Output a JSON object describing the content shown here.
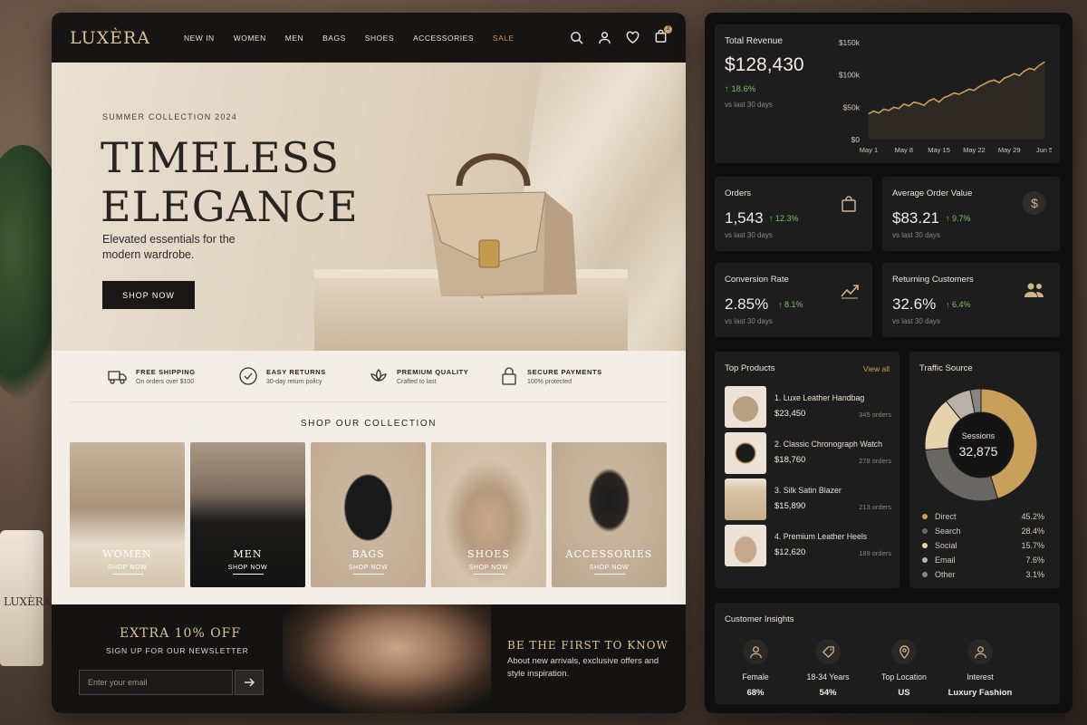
{
  "store": {
    "logo": "LUXÈRA",
    "nav": [
      "NEW IN",
      "WOMEN",
      "MEN",
      "BAGS",
      "SHOES",
      "ACCESSORIES",
      "SALE"
    ],
    "cart_count": "2",
    "hero": {
      "eyebrow": "SUMMER COLLECTION 2024",
      "title": "TIMELESS\nELEGANCE",
      "subtitle": "Elevated essentials for the modern wardrobe.",
      "cta": "SHOP NOW"
    },
    "features": [
      {
        "title": "FREE SHIPPING",
        "sub": "On orders over $100",
        "icon": "truck-icon"
      },
      {
        "title": "EASY RETURNS",
        "sub": "30-day return policy",
        "icon": "return-icon"
      },
      {
        "title": "PREMIUM QUALITY",
        "sub": "Crafted to last",
        "icon": "lotus-icon"
      },
      {
        "title": "SECURE PAYMENTS",
        "sub": "100% protected",
        "icon": "lock-icon"
      }
    ],
    "collection_title": "SHOP OUR COLLECTION",
    "categories": [
      {
        "label": "WOMEN",
        "cta": "SHOP NOW"
      },
      {
        "label": "MEN",
        "cta": "SHOP NOW"
      },
      {
        "label": "BAGS",
        "cta": "SHOP NOW"
      },
      {
        "label": "SHOES",
        "cta": "SHOP NOW"
      },
      {
        "label": "ACCESSORIES",
        "cta": "SHOP NOW"
      }
    ],
    "newsletter": {
      "headline": "EXTRA 10% OFF",
      "sub": "SIGN UP FOR OUR NEWSLETTER",
      "placeholder": "Enter your email",
      "right_title": "BE THE FIRST TO KNOW",
      "right_text": "About new arrivals, exclusive offers and style inspiration."
    }
  },
  "dashboard": {
    "revenue": {
      "title": "Total Revenue",
      "value": "$128,430",
      "change": "↑ 18.6%",
      "period": "vs last 30 days",
      "y_ticks": [
        "$150k",
        "$100k",
        "$50k",
        "$0"
      ],
      "x_ticks": [
        "May 1",
        "May 8",
        "May 15",
        "May 22",
        "May 29",
        "Jun 5"
      ]
    },
    "kpis": [
      {
        "title": "Orders",
        "value": "1,543",
        "change": "↑ 12.3%",
        "period": "vs last 30 days",
        "icon": "shopping-bag-icon"
      },
      {
        "title": "Average Order Value",
        "value": "$83.21",
        "change": "↑ 9.7%",
        "period": "vs last 30 days",
        "icon": "dollar-icon"
      },
      {
        "title": "Conversion Rate",
        "value": "2.85%",
        "change": "↑ 8.1%",
        "period": "vs last 30 days",
        "icon": "trend-up-icon"
      },
      {
        "title": "Returning Customers",
        "value": "32.6%",
        "change": "↑ 6.4%",
        "period": "vs last 30 days",
        "icon": "users-icon"
      }
    ],
    "top_products": {
      "title": "Top Products",
      "view_all": "View all",
      "items": [
        {
          "name": "1. Luxe Leather Handbag",
          "price": "$23,450",
          "orders": "345 orders"
        },
        {
          "name": "2. Classic Chronograph Watch",
          "price": "$18,760",
          "orders": "278 orders"
        },
        {
          "name": "3. Silk Satin Blazer",
          "price": "$15,890",
          "orders": "213 orders"
        },
        {
          "name": "4. Premium Leather Heels",
          "price": "$12,620",
          "orders": "189 orders"
        }
      ]
    },
    "traffic": {
      "title": "Traffic Source",
      "center_label": "Sessions",
      "center_value": "32,875",
      "sources": [
        {
          "name": "Direct",
          "pct": "45.2%",
          "value": 45.2,
          "color": "#c9a05a"
        },
        {
          "name": "Search",
          "pct": "28.4%",
          "value": 28.4,
          "color": "#6b6864"
        },
        {
          "name": "Social",
          "pct": "15.7%",
          "value": 15.7,
          "color": "#e6d2ad"
        },
        {
          "name": "Email",
          "pct": "7.6%",
          "value": 7.6,
          "color": "#b8b2a8"
        },
        {
          "name": "Other",
          "pct": "3.1%",
          "value": 3.1,
          "color": "#8a8580"
        }
      ]
    },
    "insights": {
      "title": "Customer Insights",
      "items": [
        {
          "label": "Female",
          "value": "68%",
          "icon": "person-icon"
        },
        {
          "label": "18-34 Years",
          "value": "54%",
          "icon": "tag-icon"
        },
        {
          "label": "Top Location",
          "value": "US",
          "icon": "location-pin-icon"
        },
        {
          "label": "Interest",
          "value": "Luxury Fashion",
          "icon": "person-icon"
        }
      ]
    }
  },
  "chart_data": [
    {
      "type": "line",
      "title": "Total Revenue",
      "x": [
        "May 1",
        "May 2",
        "May 3",
        "May 4",
        "May 5",
        "May 6",
        "May 7",
        "May 8",
        "May 9",
        "May 10",
        "May 11",
        "May 12",
        "May 13",
        "May 14",
        "May 15",
        "May 16",
        "May 17",
        "May 18",
        "May 19",
        "May 20",
        "May 21",
        "May 22",
        "May 23",
        "May 24",
        "May 25",
        "May 26",
        "May 27",
        "May 28",
        "May 29",
        "May 30",
        "May 31",
        "Jun 1",
        "Jun 2",
        "Jun 3",
        "Jun 4",
        "Jun 5"
      ],
      "series": [
        {
          "values": [
            40,
            44,
            41,
            47,
            45,
            50,
            48,
            55,
            52,
            58,
            56,
            53,
            60,
            63,
            58,
            65,
            68,
            72,
            70,
            74,
            78,
            76,
            82,
            86,
            90,
            92,
            88,
            95,
            98,
            102,
            99,
            106,
            110,
            108,
            115,
            120
          ]
        }
      ],
      "ylim": [
        0,
        150
      ],
      "x_ticks": [
        "May 1",
        "May 8",
        "May 15",
        "May 22",
        "May 29",
        "Jun 5"
      ],
      "y_ticks": [
        "$0",
        "$50k",
        "$100k",
        "$150k"
      ],
      "grid": false
    },
    {
      "type": "pie",
      "title": "Traffic Source",
      "categories": [
        "Direct",
        "Search",
        "Social",
        "Email",
        "Other"
      ],
      "values": [
        45.2,
        28.4,
        15.7,
        7.6,
        3.1
      ]
    }
  ]
}
